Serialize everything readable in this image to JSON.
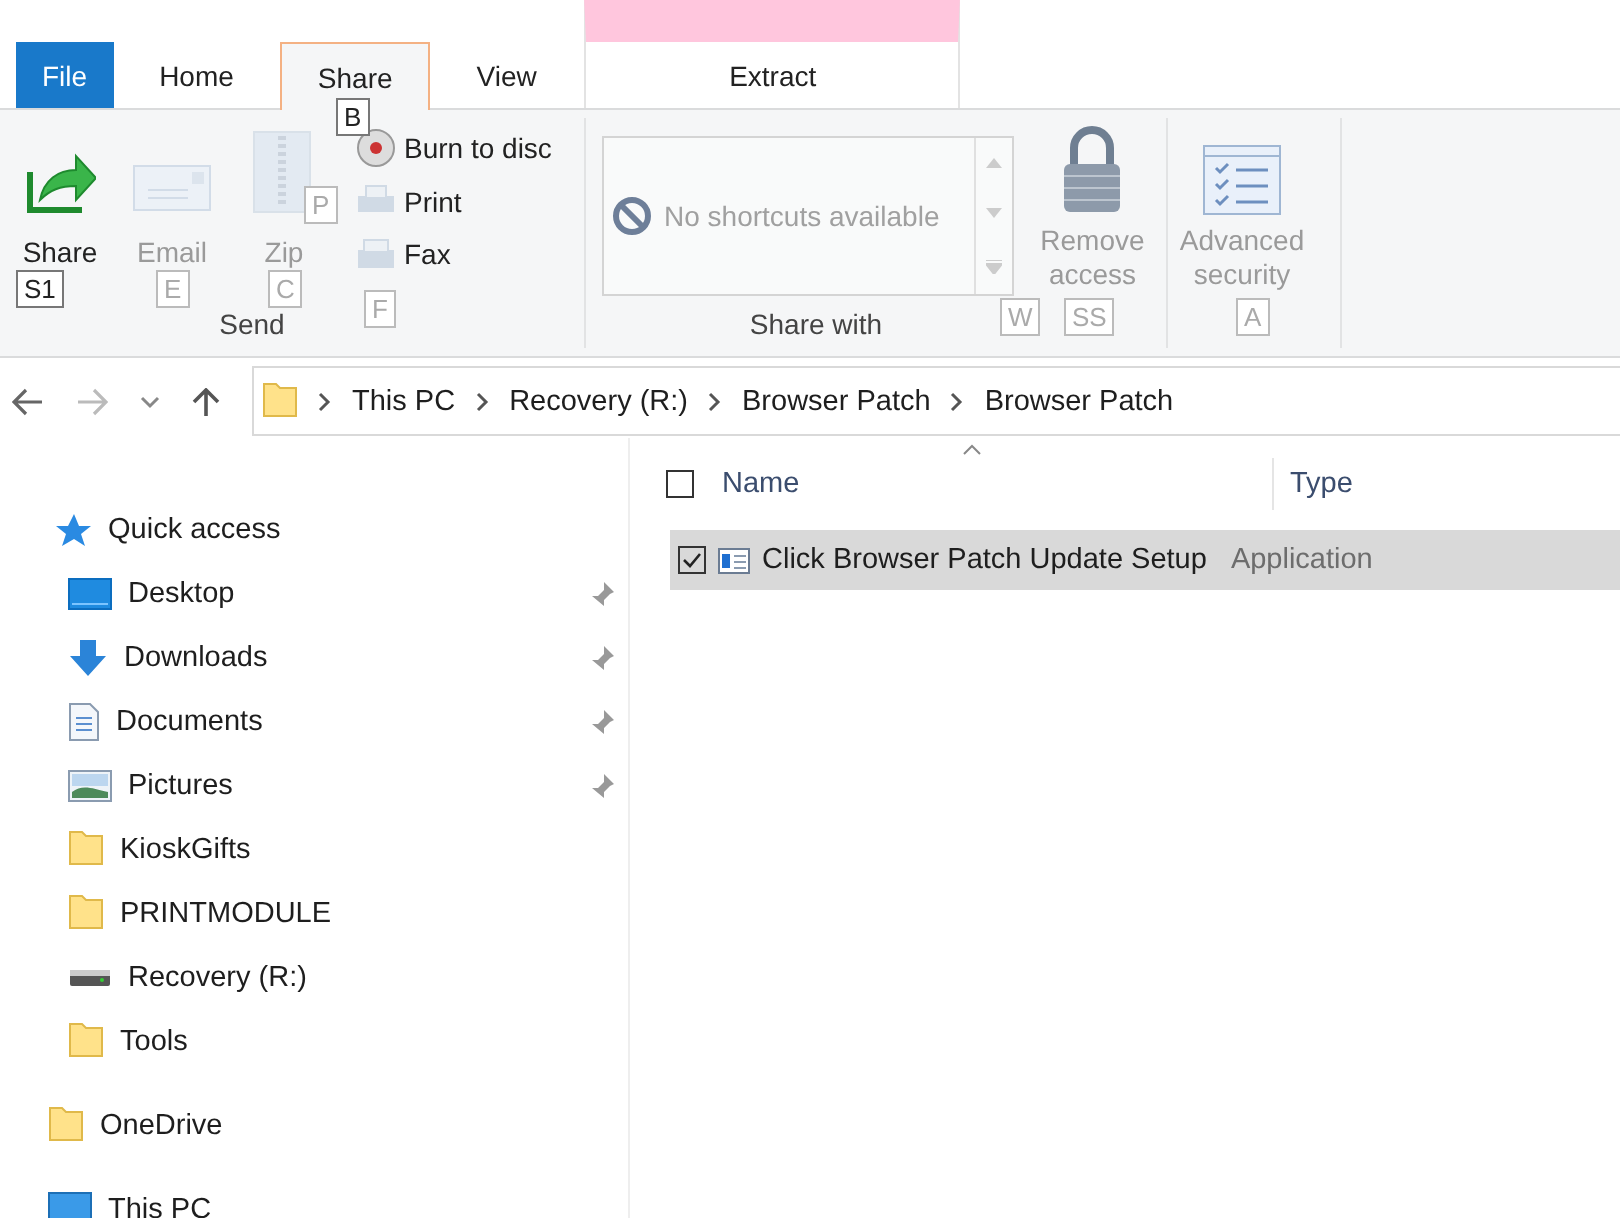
{
  "tabs": [
    {
      "label": "File",
      "kind": "file",
      "selected": false
    },
    {
      "label": "Home",
      "kind": "tab",
      "selected": false
    },
    {
      "label": "Share",
      "kind": "tab",
      "selected": true,
      "key_tip": "B"
    },
    {
      "label": "View",
      "kind": "tab",
      "selected": false
    },
    {
      "label": "Extract",
      "kind": "contextual",
      "selected": false
    }
  ],
  "ribbon": {
    "send": {
      "label": "Send",
      "large": [
        {
          "label": "Share",
          "key_tip": "S1",
          "disabled": false
        },
        {
          "label": "Email",
          "key_tip": "E",
          "disabled": true
        },
        {
          "label": "Zip",
          "key_tip": "C",
          "disabled": true
        }
      ],
      "small": [
        {
          "label": "Burn to disc",
          "disabled": false
        },
        {
          "label": "Print",
          "key_tip": "P",
          "disabled": true
        },
        {
          "label": "Fax",
          "key_tip": "F",
          "disabled": true
        }
      ]
    },
    "share_with": {
      "label": "Share with",
      "gallery_text": "No shortcuts available",
      "gallery_key_tip": "W",
      "button": {
        "label": "Remove access",
        "key_tip": "SS",
        "disabled": true
      }
    },
    "security": {
      "button": {
        "label": "Advanced security",
        "key_tip": "A",
        "disabled": true
      }
    }
  },
  "address": {
    "breadcrumbs": [
      "This PC",
      "Recovery (R:)",
      "Browser Patch",
      "Browser Patch"
    ]
  },
  "sidebar": {
    "items": [
      {
        "label": "Quick access",
        "kind": "quick",
        "children": [
          {
            "label": "Desktop",
            "kind": "desktop",
            "pinned": true
          },
          {
            "label": "Downloads",
            "kind": "downloads",
            "pinned": true
          },
          {
            "label": "Documents",
            "kind": "documents",
            "pinned": true
          },
          {
            "label": "Pictures",
            "kind": "pictures",
            "pinned": true
          },
          {
            "label": "KioskGifts",
            "kind": "folder",
            "pinned": false
          },
          {
            "label": "PRINTMODULE",
            "kind": "folder",
            "pinned": false
          },
          {
            "label": "Recovery (R:)",
            "kind": "drive",
            "pinned": false
          },
          {
            "label": "Tools",
            "kind": "folder",
            "pinned": false
          }
        ]
      },
      {
        "label": "OneDrive",
        "kind": "folder"
      },
      {
        "label": "This PC",
        "kind": "pc"
      }
    ]
  },
  "table": {
    "all_selected": false,
    "columns": [
      {
        "label": "Name",
        "sorted": true
      },
      {
        "label": "Type",
        "sorted": false
      }
    ],
    "rows": [
      {
        "name": "Click Browser Patch Update Setup",
        "type": "Application",
        "selected": true,
        "checked": true
      }
    ]
  }
}
